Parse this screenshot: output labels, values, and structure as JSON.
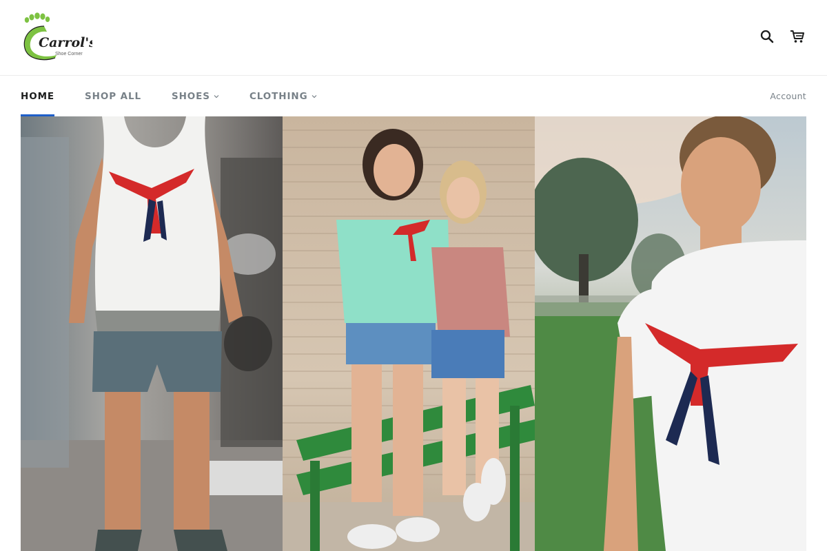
{
  "header": {
    "logo_text": "Carrol's",
    "logo_subtext": "Shoe Corner",
    "search_icon": "search-icon",
    "cart_icon": "cart-icon"
  },
  "nav": {
    "items": [
      {
        "label": "HOME",
        "active": true,
        "has_dropdown": false
      },
      {
        "label": "SHOP ALL",
        "active": false,
        "has_dropdown": false
      },
      {
        "label": "SHOES",
        "active": false,
        "has_dropdown": true
      },
      {
        "label": "CLOTHING",
        "active": false,
        "has_dropdown": true
      }
    ],
    "account_label": "Account"
  },
  "hero": {
    "images": [
      {
        "subject": "man in white tank top with red bird graphic"
      },
      {
        "subject": "two girls posing by brick wall on green bench"
      },
      {
        "subject": "boy in white t-shirt with red bird graphic outdoors"
      }
    ]
  },
  "colors": {
    "accent": "#1f5fc9",
    "nav_text": "#788188",
    "nav_active": "#1c1d1d",
    "logo_green": "#7dc242"
  }
}
